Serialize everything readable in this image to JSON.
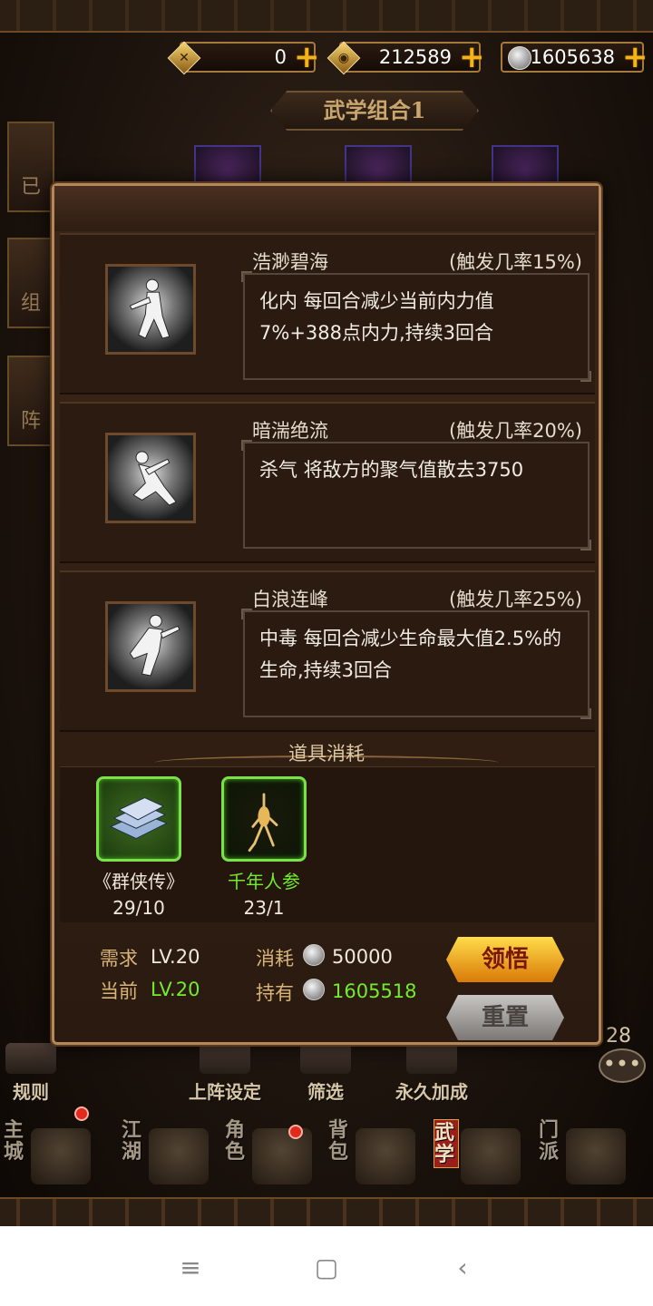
{
  "currencies": {
    "token": {
      "icon": "crossed-swords-token-icon",
      "value": "0"
    },
    "jade": {
      "icon": "jade-coin-icon",
      "value": "212589"
    },
    "silver": {
      "icon": "silver-coin-icon",
      "value": "1605638"
    }
  },
  "combo_title": "武学组合1",
  "left_tabs": [
    "已",
    "组",
    "阵"
  ],
  "modal": {
    "skills": [
      {
        "name": "浩渺碧海",
        "rate": "(触发几率15%)",
        "desc": "化内  每回合减少当前内力值7%+388点内力,持续3回合"
      },
      {
        "name": "暗湍绝流",
        "rate": "(触发几率20%)",
        "desc": "杀气  将敌方的聚气值散去3750"
      },
      {
        "name": "白浪连峰",
        "rate": "(触发几率25%)",
        "desc": "中毒  每回合减少生命最大值2.5%的生命,持续3回合"
      }
    ],
    "items_title": "道具消耗",
    "items": [
      {
        "name": "《群侠传》",
        "count": "29/10",
        "icon": "book-stack-icon"
      },
      {
        "name": "千年人参",
        "count": "23/1",
        "icon": "ginseng-icon"
      }
    ],
    "requirements": {
      "need_label": "需求",
      "need_value": "LV.20",
      "current_label": "当前",
      "current_value": "LV.20",
      "cost_label": "消耗",
      "cost_value": "50000",
      "hold_label": "持有",
      "hold_value": "1605518"
    },
    "buttons": {
      "learn": "领悟",
      "reset": "重置"
    }
  },
  "toolbar": [
    "规则",
    "上阵设定",
    "筛选",
    "永久加成"
  ],
  "chat_badge": "28",
  "nav": [
    {
      "label": "主城"
    },
    {
      "label": "江湖"
    },
    {
      "label": "角色"
    },
    {
      "label": "背包"
    },
    {
      "label": "武学",
      "active": true
    },
    {
      "label": "门派"
    }
  ],
  "system_nav": {
    "menu": "≡",
    "home": "▢",
    "back": "‹"
  }
}
